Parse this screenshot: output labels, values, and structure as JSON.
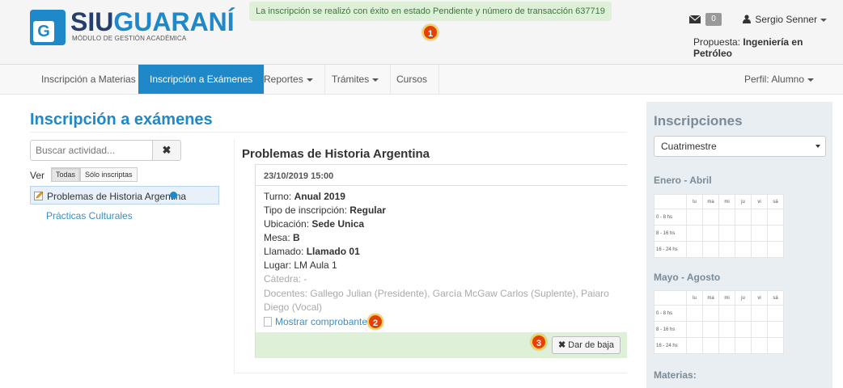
{
  "header": {
    "logo_main_a": "SIU",
    "logo_main_b": "GUARANÍ",
    "logo_sub": "MÓDULO DE GESTIÓN ACADÉMICA",
    "logo_letter": "G",
    "alert": "La inscripción se realizó con éxito en estado Pendiente y número de transacción 637719",
    "mail_count": "0",
    "user_name": "Sergio Senner",
    "propuesta_label": "Propuesta:",
    "propuesta_value": "Ingeniería en Petróleo"
  },
  "markers": [
    "1",
    "2",
    "3"
  ],
  "nav": {
    "items": [
      "Inscripción a Materias",
      "Inscripción a Exámenes",
      "Reportes",
      "Trámites",
      "Cursos"
    ],
    "perfil": "Perfil: Alumno"
  },
  "left": {
    "title": "Inscripción a exámenes",
    "search_placeholder": "Buscar actividad...",
    "search_clear": "✖",
    "ver_label": "Ver",
    "filter_all": "Todas",
    "filter_inscriptas": "Sólo inscriptas",
    "activities": [
      "Problemas de Historia Argentina",
      "Prácticas Culturales"
    ]
  },
  "exam": {
    "title": "Problemas de Historia Argentina",
    "date": "23/10/2019 15:00",
    "turno_label": "Turno:",
    "turno_value": "Anual 2019",
    "tipo_label": "Tipo de inscripción:",
    "tipo_value": "Regular",
    "ubicacion_label": "Ubicación:",
    "ubicacion_value": "Sede Unica",
    "mesa_label": "Mesa:",
    "mesa_value": "B",
    "llamado_label": "Llamado:",
    "llamado_value": "Llamado 01",
    "lugar": "Lugar: LM Aula 1",
    "catedra": "Cátedra: -",
    "docentes": "Docentes: Gallego Julian (Presidente), García McGaw Carlos (Suplente), Paiaro Diego (Vocal)",
    "comprobante": "Mostrar comprobante",
    "baja_icon": "✖",
    "baja_label": "Dar de baja"
  },
  "sidebar": {
    "title": "Inscripciones",
    "select_value": "Cuatrimestre",
    "period1": "Enero - Abril",
    "period2": "Mayo - Agosto",
    "materias": "Materias:",
    "days": [
      "lu",
      "ma",
      "mi",
      "ju",
      "vi",
      "sá"
    ],
    "slots": [
      "0 - 8 hs",
      "8 - 16 hs",
      "16 - 24 hs"
    ]
  },
  "colors": {
    "brand_blue": "#1e88c8",
    "brand_dark": "#263e6e",
    "alert_bg": "#dff0d8",
    "marker": "#e4400a"
  }
}
